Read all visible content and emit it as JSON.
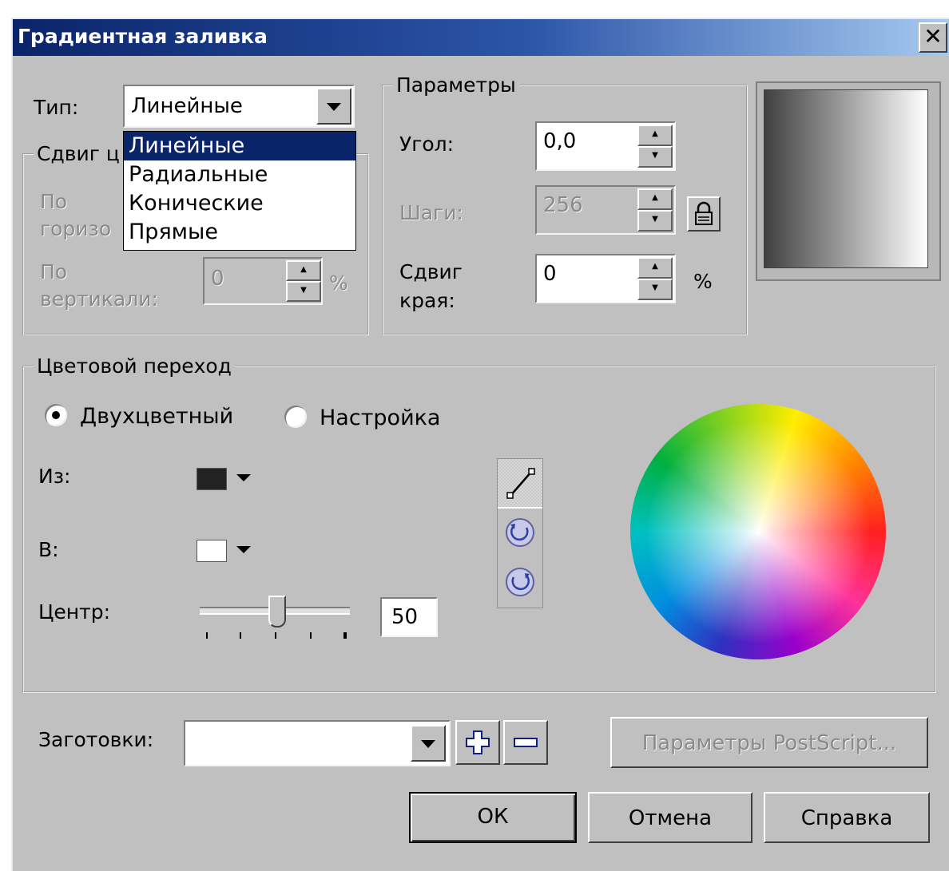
{
  "dialog": {
    "title": "Градиентная заливка",
    "close_glyph": "✕"
  },
  "type": {
    "label": "Тип:",
    "value": "Линейные",
    "options": [
      "Линейные",
      "Радиальные",
      "Конические",
      "Прямые"
    ],
    "selected_index": 0
  },
  "center_offset": {
    "group_title": "Сдвиг ц",
    "horizontal_label_1": "По",
    "horizontal_label_2": "горизо",
    "vertical_label_1": "По",
    "vertical_label_2": "вертикали:",
    "vertical_value": "0",
    "vertical_unit": "%"
  },
  "options": {
    "group_title": "Параметры",
    "angle_label": "Угол:",
    "angle_value": "0,0",
    "steps_label": "Шаги:",
    "steps_value": "256",
    "edge_pad_label_1": "Сдвиг",
    "edge_pad_label_2": "края:",
    "edge_pad_value": "0",
    "edge_pad_unit": "%"
  },
  "color_blend": {
    "group_title": "Цветовой переход",
    "two_color_label": "Двухцветный",
    "custom_label": "Настройка",
    "from_label": "Из:",
    "from_color": "#222222",
    "to_label": "В:",
    "to_color": "#ffffff",
    "mid_point_label": "Центр:",
    "mid_point_value": "50"
  },
  "presets": {
    "label": "Заготовки:",
    "value": ""
  },
  "buttons": {
    "postscript": "Параметры PostScript...",
    "ok": "ОК",
    "cancel": "Отмена",
    "help": "Справка"
  }
}
